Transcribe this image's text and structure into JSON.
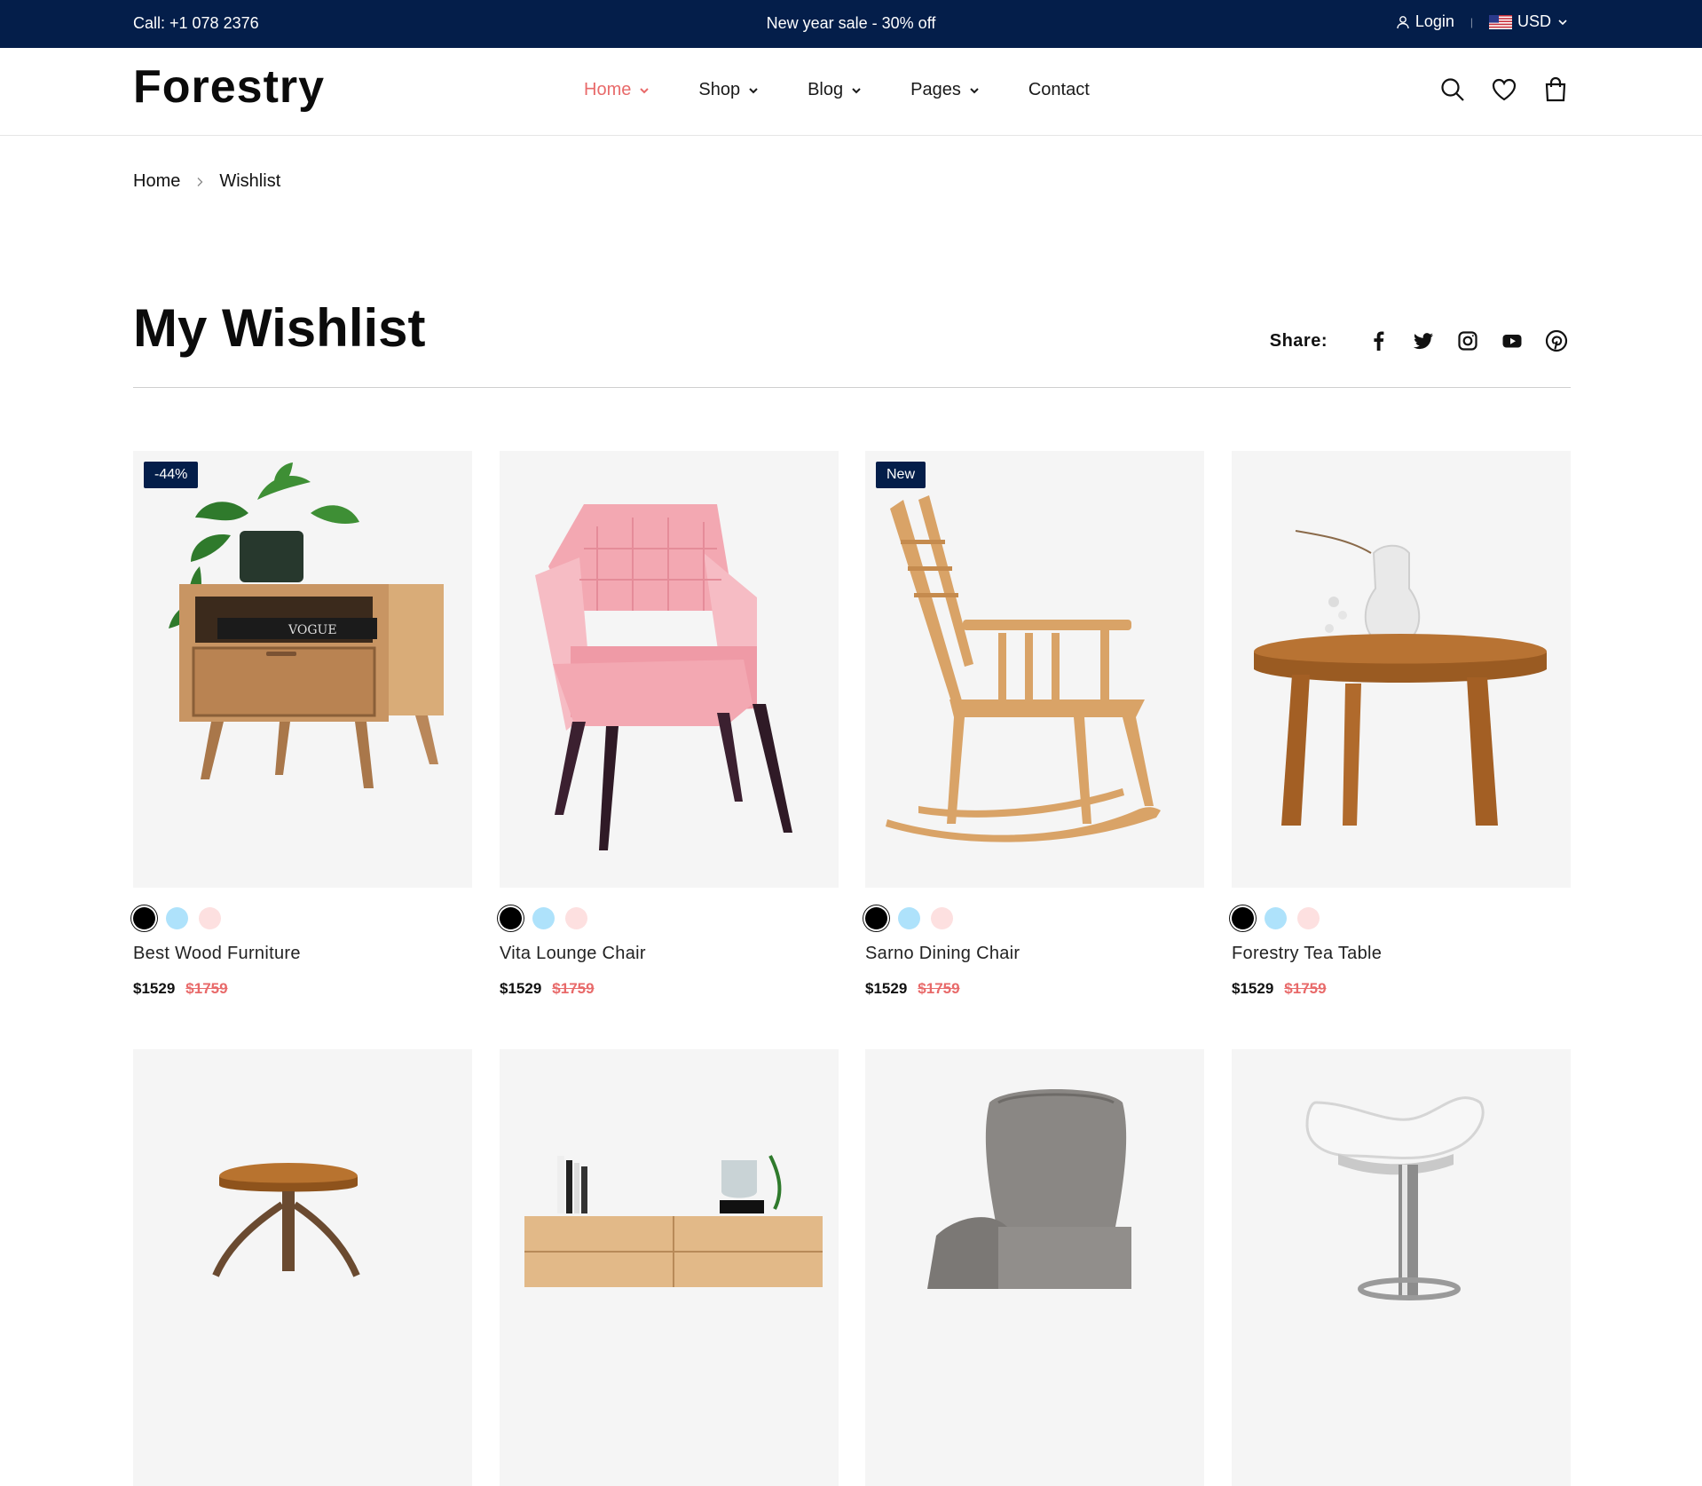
{
  "topbar": {
    "call": "Call: +1 078 2376",
    "promo": "New year sale - 30% off",
    "login": "Login",
    "currency": "USD"
  },
  "header": {
    "logo": "Forestry",
    "nav": [
      {
        "label": "Home",
        "active": true
      },
      {
        "label": "Shop"
      },
      {
        "label": "Blog"
      },
      {
        "label": "Pages"
      },
      {
        "label": "Contact"
      }
    ],
    "icons": [
      "search-icon",
      "heart-icon",
      "bag-icon"
    ]
  },
  "breadcrumb": {
    "home": "Home",
    "current": "Wishlist"
  },
  "page": {
    "title": "My Wishlist",
    "share_label": "Share:"
  },
  "share_icons": [
    "facebook-icon",
    "twitter-icon",
    "instagram-icon",
    "youtube-icon",
    "pinterest-icon"
  ],
  "swatch_colors": [
    "#000000",
    "#aee2fb",
    "#fde0e0"
  ],
  "colors": {
    "navy": "#041e4a",
    "accent": "#e86a6a",
    "card_bg": "#f5f5f5"
  },
  "products": [
    {
      "name": "Best Wood Furniture",
      "price": "$1529",
      "old_price": "$1759",
      "badge": "-44%"
    },
    {
      "name": "Vita Lounge Chair",
      "price": "$1529",
      "old_price": "$1759",
      "badge": ""
    },
    {
      "name": "Sarno Dining Chair",
      "price": "$1529",
      "old_price": "$1759",
      "badge": "New"
    },
    {
      "name": "Forestry Tea Table",
      "price": "$1529",
      "old_price": "$1759",
      "badge": ""
    },
    {
      "name": "",
      "price": "",
      "old_price": "",
      "badge": ""
    },
    {
      "name": "",
      "price": "",
      "old_price": "",
      "badge": ""
    },
    {
      "name": "",
      "price": "",
      "old_price": "",
      "badge": ""
    },
    {
      "name": "",
      "price": "",
      "old_price": "",
      "badge": ""
    }
  ],
  "book_label": "VOGUE"
}
